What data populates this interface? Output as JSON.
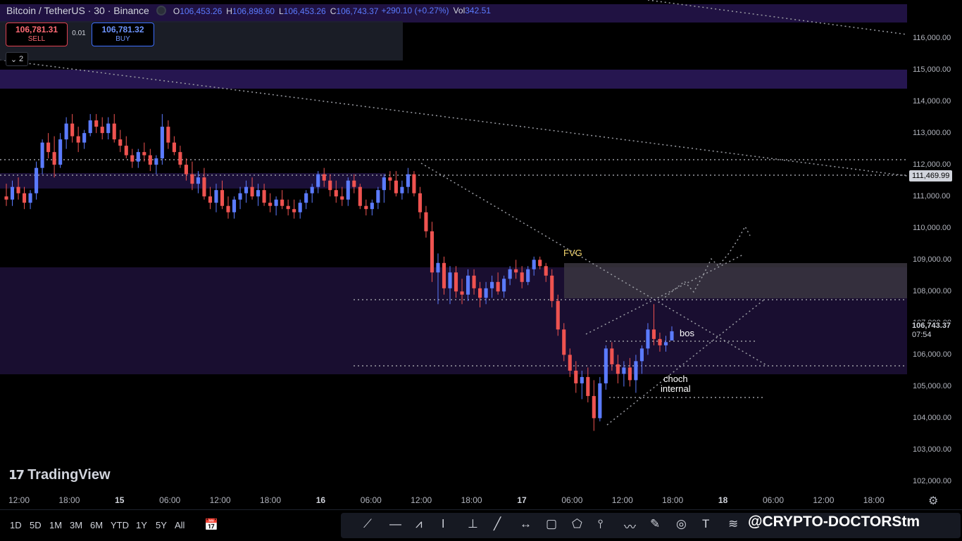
{
  "header": {
    "symbol": "Bitcoin / TetherUS · 30 · Binance",
    "ohlc": [
      {
        "label": "O",
        "value": "106,453.26"
      },
      {
        "label": "H",
        "value": "106,898.60"
      },
      {
        "label": "L",
        "value": "106,453.26"
      },
      {
        "label": "C",
        "value": "106,743.37"
      }
    ],
    "change": "+290.10 (+0.27%)",
    "vol_label": "Vol",
    "vol_value": "342.51"
  },
  "trade": {
    "sell_price": "106,781.31",
    "sell_label": "SELL",
    "spread": "0.01",
    "buy_price": "106,781.32",
    "buy_label": "BUY",
    "collapsed_count": "2"
  },
  "price_axis": {
    "ticks": [
      "116,000.00",
      "115,000.00",
      "114,000.00",
      "113,000.00",
      "112,000.00",
      "111,000.00",
      "110,000.00",
      "109,000.00",
      "108,000.00",
      "107,000.00",
      "106,000.00",
      "105,000.00",
      "104,000.00",
      "103,000.00",
      "102,000.00"
    ],
    "tick_values": [
      116000,
      115000,
      114000,
      113000,
      112000,
      111000,
      110000,
      109000,
      108000,
      107000,
      106000,
      105000,
      104000,
      103000,
      102000
    ],
    "line_label": "111,469.99",
    "last_price": "106,743.37",
    "countdown": "07:54"
  },
  "time_axis": {
    "ticks": [
      {
        "label": "12:00",
        "bold": false
      },
      {
        "label": "18:00",
        "bold": false
      },
      {
        "label": "15",
        "bold": true
      },
      {
        "label": "06:00",
        "bold": false
      },
      {
        "label": "12:00",
        "bold": false
      },
      {
        "label": "18:00",
        "bold": false
      },
      {
        "label": "16",
        "bold": true
      },
      {
        "label": "06:00",
        "bold": false
      },
      {
        "label": "12:00",
        "bold": false
      },
      {
        "label": "18:00",
        "bold": false
      },
      {
        "label": "17",
        "bold": true
      },
      {
        "label": "06:00",
        "bold": false
      },
      {
        "label": "12:00",
        "bold": false
      },
      {
        "label": "18:00",
        "bold": false
      },
      {
        "label": "18",
        "bold": true
      },
      {
        "label": "06:00",
        "bold": false
      },
      {
        "label": "12:00",
        "bold": false
      },
      {
        "label": "18:00",
        "bold": false
      }
    ]
  },
  "annotations": {
    "fvg": "FVG",
    "bos": "bos",
    "choch": "choch",
    "internal": "internal"
  },
  "logo": "TradingView",
  "ranges": [
    "1D",
    "5D",
    "1M",
    "3M",
    "6M",
    "YTD",
    "1Y",
    "5Y",
    "All"
  ],
  "drawing_tools": [
    "draw-icon",
    "line-icon",
    "pattern-icon",
    "vertical-line-icon",
    "measure-icon",
    "trendline-icon",
    "horizontal-ray-icon",
    "rectangle-icon",
    "polygon-icon",
    "position-icon",
    "path-icon",
    "brush-icon",
    "circle-icon",
    "text-icon",
    "fib-icon"
  ],
  "watermark": "@CRYPTO-DOCTORStm",
  "colors": {
    "up": "#5b7bff",
    "down": "#ef5350",
    "zone": "#1a0f33",
    "zone_band": "#2d1a5e",
    "fvg_zone": "#3a3540"
  },
  "chart_data": {
    "type": "candlestick",
    "title": "Bitcoin / TetherUS · 30 · Binance",
    "ylim": [
      101700,
      117200
    ],
    "ohlc_series": [
      [
        111000,
        111400,
        110700,
        110900
      ],
      [
        110900,
        111500,
        110700,
        111300
      ],
      [
        111300,
        111600,
        110900,
        111100
      ],
      [
        111100,
        111300,
        110600,
        110800
      ],
      [
        110800,
        111200,
        110600,
        111100
      ],
      [
        111100,
        112100,
        110900,
        111900
      ],
      [
        111900,
        112800,
        111700,
        112700
      ],
      [
        112700,
        113000,
        112200,
        112400
      ],
      [
        112400,
        112900,
        111600,
        112000
      ],
      [
        112000,
        113000,
        111900,
        112800
      ],
      [
        112800,
        113500,
        112500,
        113300
      ],
      [
        113300,
        113600,
        112700,
        112900
      ],
      [
        112900,
        113200,
        112400,
        112700
      ],
      [
        112700,
        113100,
        112500,
        113000
      ],
      [
        113000,
        113600,
        112900,
        113400
      ],
      [
        113400,
        113600,
        113000,
        113200
      ],
      [
        113200,
        113500,
        112800,
        113000
      ],
      [
        113000,
        113500,
        112800,
        113300
      ],
      [
        113300,
        113600,
        112700,
        112800
      ],
      [
        112800,
        113100,
        112400,
        112600
      ],
      [
        112600,
        112900,
        112200,
        112300
      ],
      [
        112300,
        112500,
        111900,
        112100
      ],
      [
        112100,
        112500,
        111900,
        112400
      ],
      [
        112400,
        112700,
        112100,
        112300
      ],
      [
        112300,
        112500,
        111800,
        112000
      ],
      [
        112000,
        112300,
        111700,
        112200
      ],
      [
        112200,
        113600,
        112000,
        113200
      ],
      [
        113200,
        113400,
        112500,
        112700
      ],
      [
        112700,
        112900,
        112300,
        112400
      ],
      [
        112400,
        112600,
        111900,
        112000
      ],
      [
        112000,
        112200,
        111500,
        111700
      ],
      [
        111700,
        112100,
        111200,
        111400
      ],
      [
        111400,
        111800,
        111100,
        111600
      ],
      [
        111600,
        111900,
        110900,
        111000
      ],
      [
        111000,
        111300,
        110600,
        110800
      ],
      [
        110800,
        111400,
        110500,
        111200
      ],
      [
        111200,
        111500,
        110600,
        110700
      ],
      [
        110700,
        111000,
        110300,
        110500
      ],
      [
        110500,
        111000,
        110300,
        110900
      ],
      [
        110900,
        111300,
        110600,
        111100
      ],
      [
        111100,
        111500,
        110800,
        111300
      ],
      [
        111300,
        111600,
        110900,
        111000
      ],
      [
        111000,
        111400,
        110700,
        111200
      ],
      [
        111200,
        111400,
        110700,
        110800
      ],
      [
        110800,
        111100,
        110500,
        110700
      ],
      [
        110700,
        111000,
        110400,
        110900
      ],
      [
        110900,
        111200,
        110600,
        110700
      ],
      [
        110700,
        110900,
        110400,
        110600
      ],
      [
        110600,
        110900,
        110300,
        110500
      ],
      [
        110500,
        110900,
        110300,
        110800
      ],
      [
        110800,
        111200,
        110600,
        111100
      ],
      [
        111100,
        111400,
        110800,
        111300
      ],
      [
        111300,
        111800,
        111100,
        111700
      ],
      [
        111700,
        111900,
        111300,
        111500
      ],
      [
        111500,
        111700,
        111000,
        111200
      ],
      [
        111200,
        111500,
        110800,
        111000
      ],
      [
        111000,
        111300,
        110700,
        110900
      ],
      [
        110900,
        111600,
        110700,
        111500
      ],
      [
        111500,
        111700,
        111100,
        111300
      ],
      [
        111300,
        111400,
        110600,
        110700
      ],
      [
        110700,
        110900,
        110400,
        110600
      ],
      [
        110600,
        110900,
        110400,
        110800
      ],
      [
        110800,
        111300,
        110600,
        111200
      ],
      [
        111200,
        111700,
        110800,
        111600
      ],
      [
        111600,
        111800,
        111200,
        111500
      ],
      [
        111500,
        111800,
        111000,
        111100
      ],
      [
        111100,
        111500,
        110900,
        111300
      ],
      [
        111300,
        111900,
        111100,
        111700
      ],
      [
        111700,
        111800,
        111000,
        111100
      ],
      [
        111100,
        111300,
        110300,
        110500
      ],
      [
        110500,
        110700,
        109700,
        109900
      ],
      [
        109900,
        110200,
        108300,
        108600
      ],
      [
        108600,
        109200,
        107600,
        108900
      ],
      [
        108900,
        109100,
        107900,
        108100
      ],
      [
        108100,
        108800,
        107600,
        108600
      ],
      [
        108600,
        108800,
        107800,
        108000
      ],
      [
        108000,
        108400,
        107600,
        107900
      ],
      [
        107900,
        108700,
        107700,
        108500
      ],
      [
        108500,
        108700,
        107900,
        108100
      ],
      [
        108100,
        108300,
        107500,
        107800
      ],
      [
        107800,
        108300,
        107600,
        108100
      ],
      [
        108100,
        108500,
        107800,
        108300
      ],
      [
        108300,
        108600,
        107900,
        108000
      ],
      [
        108000,
        108500,
        107800,
        108400
      ],
      [
        108400,
        108800,
        108200,
        108700
      ],
      [
        108700,
        109000,
        108400,
        108600
      ],
      [
        108600,
        108800,
        108100,
        108300
      ],
      [
        108300,
        108800,
        108200,
        108700
      ],
      [
        108700,
        109100,
        108500,
        109000
      ],
      [
        109000,
        109100,
        108700,
        108800
      ],
      [
        108800,
        108900,
        108300,
        108500
      ],
      [
        108500,
        108700,
        107500,
        107700
      ],
      [
        107700,
        107900,
        106600,
        106800
      ],
      [
        106800,
        107000,
        105800,
        106000
      ],
      [
        106000,
        106200,
        105300,
        105500
      ],
      [
        105500,
        105800,
        104800,
        105100
      ],
      [
        105100,
        105500,
        104600,
        105300
      ],
      [
        105300,
        105600,
        104500,
        104700
      ],
      [
        104700,
        105200,
        103600,
        104000
      ],
      [
        104000,
        105300,
        103900,
        105100
      ],
      [
        105100,
        106300,
        104900,
        106200
      ],
      [
        106200,
        106400,
        105500,
        105700
      ],
      [
        105700,
        106000,
        105100,
        105400
      ],
      [
        105400,
        105800,
        105000,
        105600
      ],
      [
        105600,
        105900,
        105000,
        105200
      ],
      [
        105200,
        106000,
        104800,
        105800
      ],
      [
        105800,
        106300,
        105400,
        106200
      ],
      [
        106200,
        107000,
        106000,
        106800
      ],
      [
        106800,
        107600,
        106300,
        106500
      ],
      [
        106500,
        106700,
        106100,
        106300
      ],
      [
        106300,
        106600,
        106100,
        106400
      ],
      [
        106453.26,
        106898.6,
        106453.26,
        106743.37
      ]
    ]
  }
}
